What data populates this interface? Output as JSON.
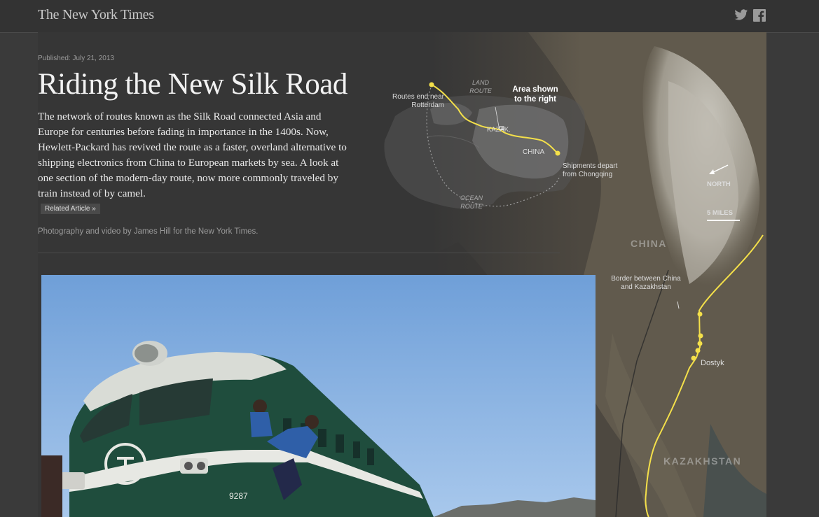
{
  "header": {
    "logo": "The New York Times",
    "share_icons": [
      "twitter-icon",
      "facebook-icon"
    ]
  },
  "article": {
    "published": "Published: July 21, 2013",
    "title": "Riding the New Silk Road",
    "summary": "The network of routes known as the Silk Road connected Asia and Europe for centuries before fading in importance in the 1400s. Now, Hewlett-Packard has revived the route as a faster, overland alternative to shipping electronics from China to European markets by sea. A look at one section of the modern-day route, now more commonly traveled by train instead of by camel.",
    "related_link": "Related Article »",
    "credit": "Photography and video by James Hill for the New York Times."
  },
  "locator_map": {
    "routes_end": "Routes end near Rotterdam",
    "land_route": "LAND ROUTE",
    "area_shown": "Area shown to the right",
    "kazak": "KAZAK.",
    "china": "CHINA",
    "shipments": "Shipments depart from Chongqing",
    "ocean_route": "OCEAN ROUTE"
  },
  "detail_map": {
    "north": "NORTH",
    "scale": "5 MILES",
    "china": "CHINA",
    "border": "Border between China and Kazakhstan",
    "dostyk": "Dostyk",
    "kazakhstan": "KAZAKHSTAN"
  },
  "colors": {
    "route": "#f4e04a",
    "background": "#3a3a3a"
  }
}
